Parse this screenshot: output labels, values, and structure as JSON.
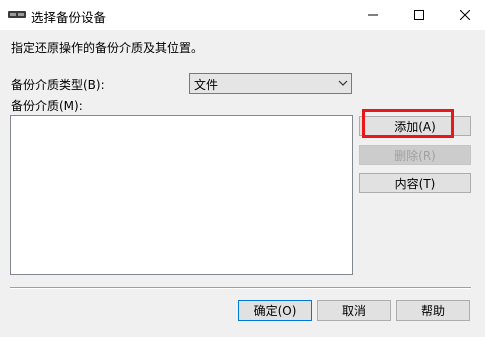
{
  "window": {
    "title": "选择备份设备",
    "minimize_icon": "minimize-icon",
    "maximize_icon": "maximize-icon",
    "close_icon": "close-icon"
  },
  "dialog": {
    "instruction": "指定还原操作的备份介质及其位置。",
    "media_type_label": "备份介质类型(B):",
    "media_type_value": "文件",
    "media_label": "备份介质(M):",
    "media_items": []
  },
  "buttons": {
    "add": "添加(A)",
    "remove": "删除(R)",
    "contents": "内容(T)",
    "ok": "确定(O)",
    "cancel": "取消",
    "help": "帮助"
  },
  "colors": {
    "highlight": "#e81818",
    "dialog_bg": "#f0f0f0",
    "default_button_border": "#0078d7"
  }
}
